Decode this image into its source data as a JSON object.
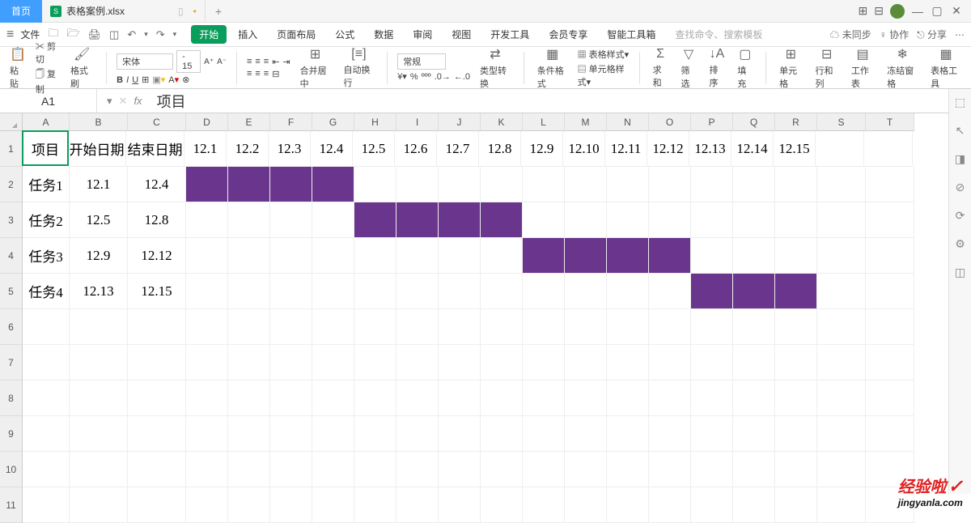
{
  "titlebar": {
    "home_tab": "首页",
    "file_name": "表格案例.xlsx",
    "tab_indicator": "▯"
  },
  "menubar": {
    "file": "文件",
    "tabs": [
      "开始",
      "插入",
      "页面布局",
      "公式",
      "数据",
      "审阅",
      "视图",
      "开发工具",
      "会员专享",
      "智能工具箱"
    ],
    "search_placeholder": "查找命令、搜索模板",
    "right": {
      "unsync": "未同步",
      "coop": "协作",
      "share": "分享"
    }
  },
  "ribbon": {
    "paste": "粘贴",
    "cut": "剪切",
    "copy": "复制",
    "formatpaint": "格式刷",
    "font_name": "宋体",
    "font_size": "15",
    "merge": "合并居中",
    "wrap": "自动换行",
    "general": "常规",
    "typeconv": "类型转换",
    "condfmt": "条件格式",
    "tablestyle": "表格样式",
    "cellstyle": "单元格样式",
    "sum": "求和",
    "filter": "筛选",
    "sort": "排序",
    "fill": "填充",
    "cellfmt": "单元格",
    "rowcol": "行和列",
    "worksheet": "工作表",
    "freeze": "冻结窗格",
    "tabletools": "表格工具"
  },
  "formulabar": {
    "namebox": "A1",
    "value": "项目"
  },
  "columns": [
    "A",
    "B",
    "C",
    "D",
    "E",
    "F",
    "G",
    "H",
    "I",
    "J",
    "K",
    "L",
    "M",
    "N",
    "O",
    "P",
    "Q",
    "R",
    "S",
    "T"
  ],
  "row_numbers": [
    "1",
    "2",
    "3",
    "4",
    "5",
    "6",
    "7",
    "8",
    "9",
    "10",
    "11"
  ],
  "headers": [
    "项目",
    "开始日期",
    "结束日期",
    "12.1",
    "12.2",
    "12.3",
    "12.4",
    "12.5",
    "12.6",
    "12.7",
    "12.8",
    "12.9",
    "12.10",
    "12.11",
    "12.12",
    "12.13",
    "12.14",
    "12.15"
  ],
  "tasks": [
    {
      "name": "任务1",
      "start": "12.1",
      "end": "12.4",
      "bar_from": 3,
      "bar_to": 6
    },
    {
      "name": "任务2",
      "start": "12.5",
      "end": "12.8",
      "bar_from": 7,
      "bar_to": 10
    },
    {
      "name": "任务3",
      "start": "12.9",
      "end": "12.12",
      "bar_from": 11,
      "bar_to": 14
    },
    {
      "name": "任务4",
      "start": "12.13",
      "end": "12.15",
      "bar_from": 15,
      "bar_to": 17
    }
  ],
  "chart_data": {
    "type": "bar",
    "title": "",
    "categories": [
      "任务1",
      "任务2",
      "任务3",
      "任务4"
    ],
    "series": [
      {
        "name": "开始",
        "values": [
          "12.1",
          "12.5",
          "12.9",
          "12.13"
        ]
      },
      {
        "name": "结束",
        "values": [
          "12.4",
          "12.8",
          "12.12",
          "12.15"
        ]
      }
    ],
    "x_dates": [
      "12.1",
      "12.2",
      "12.3",
      "12.4",
      "12.5",
      "12.6",
      "12.7",
      "12.8",
      "12.9",
      "12.10",
      "12.11",
      "12.12",
      "12.13",
      "12.14",
      "12.15"
    ],
    "color": "#6a368d"
  },
  "watermark": {
    "text": "经验啦",
    "url": "jingyanla.com"
  }
}
